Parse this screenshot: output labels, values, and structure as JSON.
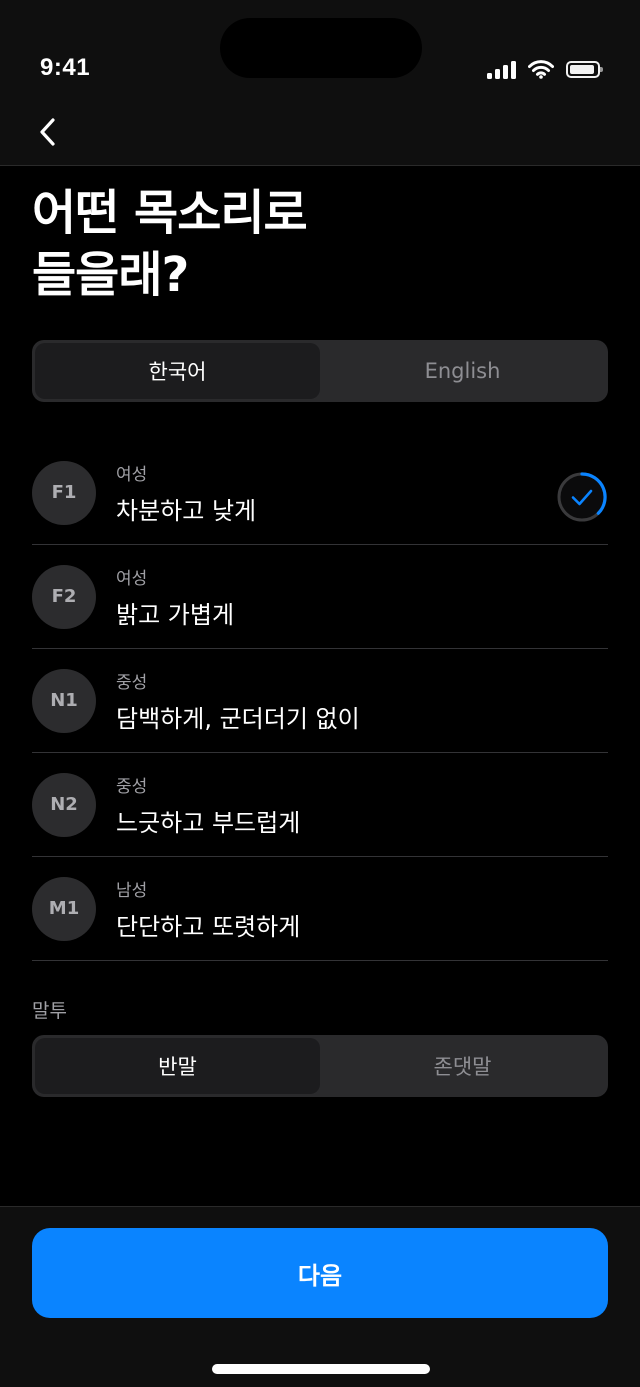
{
  "status_bar": {
    "time": "9:41"
  },
  "title": {
    "line1": "어떤 목소리로",
    "line2": "들을래?"
  },
  "language_segment": {
    "options": [
      "한국어",
      "English"
    ],
    "selected": "한국어"
  },
  "voices": [
    {
      "code": "F1",
      "tag": "여성",
      "desc": "차분하고 낮게",
      "selected": true
    },
    {
      "code": "F2",
      "tag": "여성",
      "desc": "밝고 가볍게",
      "selected": false
    },
    {
      "code": "N1",
      "tag": "중성",
      "desc": "담백하게, 군더더기 없이",
      "selected": false
    },
    {
      "code": "N2",
      "tag": "중성",
      "desc": "느긋하고 부드럽게",
      "selected": false
    },
    {
      "code": "M1",
      "tag": "남성",
      "desc": "단단하고 또렷하게",
      "selected": false
    }
  ],
  "tone": {
    "label": "말투",
    "options": [
      "반말",
      "존댓말"
    ],
    "selected": "반말"
  },
  "next_button": {
    "label": "다음"
  },
  "colors": {
    "accent": "#0a84ff",
    "background": "#000000",
    "segment_bg": "#2a2a2c"
  }
}
